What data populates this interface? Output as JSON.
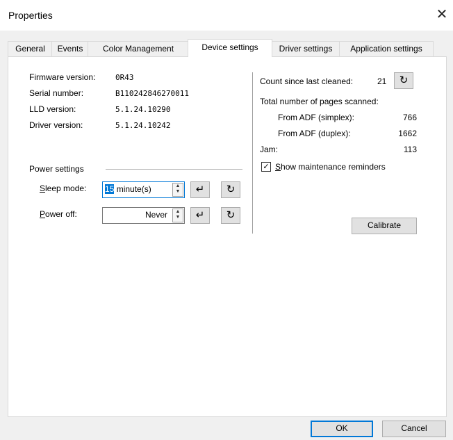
{
  "window": {
    "title": "Properties",
    "close_glyph": "✕"
  },
  "tabs": [
    {
      "label": "General"
    },
    {
      "label": "Events"
    },
    {
      "label": "Color Management"
    },
    {
      "label": "Device settings",
      "active": true
    },
    {
      "label": "Driver settings"
    },
    {
      "label": "Application settings"
    }
  ],
  "device_info": {
    "firmware_label": "Firmware version:",
    "firmware_value": "0R43",
    "serial_label": "Serial number:",
    "serial_value": "B110242846270011",
    "lld_label": "LLD version:",
    "lld_value": "5.1.24.10290",
    "driver_label": "Driver version:",
    "driver_value": "5.1.24.10242"
  },
  "power_settings": {
    "group_label": "Power settings",
    "sleep_mode": {
      "label_first": "S",
      "label_rest": "leep mode:",
      "value_selected": "15",
      "unit": " minute(s)"
    },
    "power_off": {
      "label_first": "P",
      "label_rest": "ower off:",
      "value": "Never"
    },
    "apply_icon": "enter-arrow-icon",
    "reset_icon": "refresh-icon"
  },
  "maintenance": {
    "count_label": "Count since last cleaned:",
    "count_value": "21",
    "total_label": "Total number of pages scanned:",
    "simplex_label": "From ADF (simplex):",
    "simplex_value": "766",
    "duplex_label": "From ADF (duplex):",
    "duplex_value": "1662",
    "jam_label": "Jam:",
    "jam_value": "113",
    "reminders_checked": true,
    "reminders_label_first": "S",
    "reminders_label_rest": "how maintenance reminders",
    "calibrate_label": "Calibrate"
  },
  "footer": {
    "ok_label": "OK",
    "cancel_label": "Cancel"
  }
}
